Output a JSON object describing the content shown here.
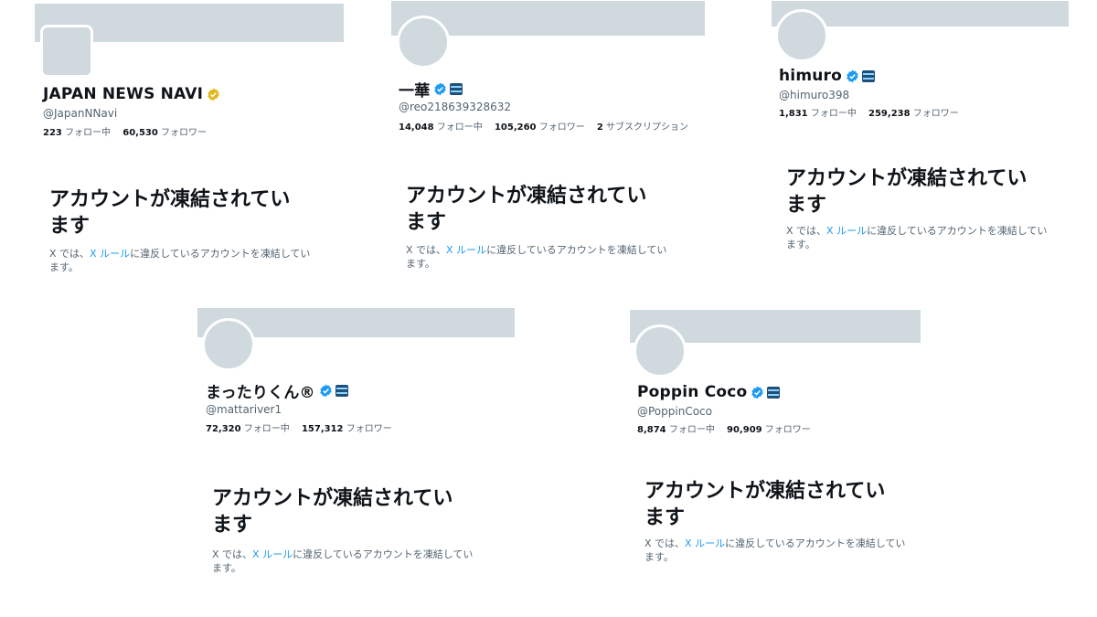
{
  "suspended_title": "アカウントが凍結されています",
  "suspended_title_line1": "アカウントが凍結されてい",
  "suspended_title_line2": "ます",
  "notice_prefix": "X では、",
  "notice_link": "X ルール",
  "notice_suffix_line1": "に違反しているアカウントを凍結してい",
  "notice_suffix_line2": "ます。",
  "colors": {
    "banner": "#cfd9de",
    "link": "#1d9bf0",
    "verified_blue": "#1d9bf0",
    "verified_gold": "#e2b719",
    "muted": "#536471"
  },
  "profiles": [
    {
      "display_name": "JAPAN NEWS NAVI",
      "handle": "@JapanNNavi",
      "badge": "gold-verified-icon",
      "affiliate_badge": false,
      "following_count": "223",
      "following_label": "フォロー中",
      "followers_count": "60,530",
      "followers_label": "フォロワー"
    },
    {
      "display_name": "一華",
      "handle": "@reo218639328632",
      "badge": "blue-verified-icon",
      "affiliate_badge": true,
      "following_count": "14,048",
      "following_label": "フォロー中",
      "followers_count": "105,260",
      "followers_label": "フォロワー",
      "subscriptions_count": "2",
      "subscriptions_label": "サブスクリプション"
    },
    {
      "display_name": "himuro",
      "handle": "@himuro398",
      "badge": "blue-verified-icon",
      "affiliate_badge": true,
      "following_count": "1,831",
      "following_label": "フォロー中",
      "followers_count": "259,238",
      "followers_label": "フォロワー"
    },
    {
      "display_name": "まったりくん®",
      "handle": "@mattariver1",
      "badge": "blue-verified-icon",
      "affiliate_badge": true,
      "following_count": "72,320",
      "following_label": "フォロー中",
      "followers_count": "157,312",
      "followers_label": "フォロワー"
    },
    {
      "display_name": "Poppin Coco",
      "handle": "@PoppinCoco",
      "badge": "blue-verified-icon",
      "affiliate_badge": true,
      "following_count": "8,874",
      "following_label": "フォロー中",
      "followers_count": "90,909",
      "followers_label": "フォロワー"
    }
  ]
}
